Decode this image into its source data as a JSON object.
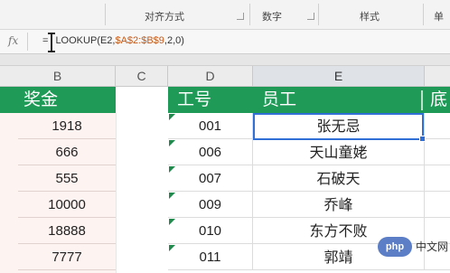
{
  "ribbon": {
    "groups": [
      "对齐方式",
      "数字",
      "样式",
      "单"
    ]
  },
  "formula_bar": {
    "fx_label": "fx",
    "formula_prefix": "=",
    "formula_main": "LOOKUP(E2,",
    "formula_ref": "$A$2:$B$9",
    "formula_suffix": ",2,0)"
  },
  "columns": [
    "B",
    "C",
    "D",
    "E"
  ],
  "header_row": {
    "b": "奖金",
    "d": "工号",
    "e": "员工",
    "f": "底"
  },
  "rows": [
    {
      "bonus": "1918",
      "id": "001",
      "name": "张无忌"
    },
    {
      "bonus": "666",
      "id": "006",
      "name": "天山童姥"
    },
    {
      "bonus": "555",
      "id": "007",
      "name": "石破天"
    },
    {
      "bonus": "10000",
      "id": "009",
      "name": "乔峰"
    },
    {
      "bonus": "18888",
      "id": "010",
      "name": "东方不败"
    },
    {
      "bonus": "7777",
      "id": "011",
      "name": "郭靖"
    }
  ],
  "watermark": {
    "logo": "php",
    "text": "中文网"
  },
  "colors": {
    "header_green": "#1f9b57",
    "selection_blue": "#2f6fd6",
    "bonus_bg": "#fdf3f1"
  }
}
